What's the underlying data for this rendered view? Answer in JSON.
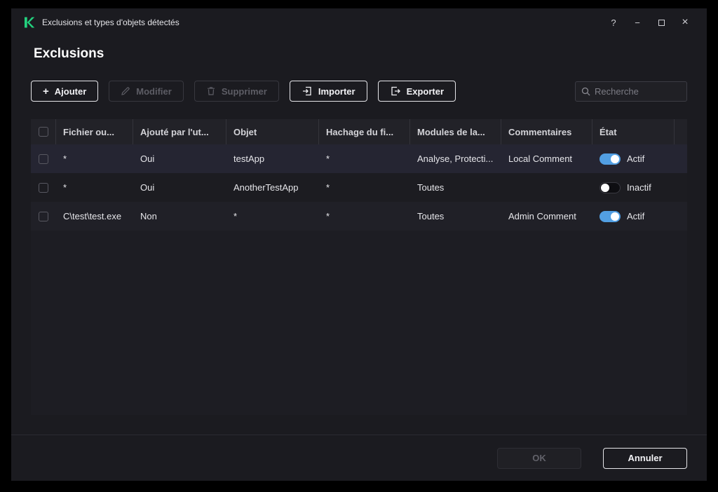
{
  "window": {
    "title": "Exclusions et types d'objets détectés",
    "controls": {
      "help": "?",
      "minimize": "−",
      "close": "×"
    }
  },
  "page": {
    "title": "Exclusions"
  },
  "toolbar": {
    "add": "Ajouter",
    "edit": "Modifier",
    "delete": "Supprimer",
    "import": "Importer",
    "export": "Exporter",
    "search_placeholder": "Recherche"
  },
  "table": {
    "columns": [
      "Fichier ou...",
      "Ajouté par l'ut...",
      "Objet",
      "Hachage du fi...",
      "Modules de la...",
      "Commentaires",
      "État"
    ],
    "rows": [
      {
        "file": "*",
        "added_by_user": "Oui",
        "object": "testApp",
        "hash": "*",
        "modules": "Analyse, Protecti...",
        "comment": "Local Comment",
        "state": "Actif",
        "enabled": true
      },
      {
        "file": "*",
        "added_by_user": "Oui",
        "object": "AnotherTestApp",
        "hash": "*",
        "modules": "Toutes",
        "comment": "",
        "state": "Inactif",
        "enabled": false
      },
      {
        "file": "C\\test\\test.exe",
        "added_by_user": "Non",
        "object": "*",
        "hash": "*",
        "modules": "Toutes",
        "comment": "Admin Comment",
        "state": "Actif",
        "enabled": true
      }
    ]
  },
  "footer": {
    "ok": "OK",
    "cancel": "Annuler"
  },
  "colors": {
    "accent_blue": "#529fe3",
    "brand_green": "#23d17e"
  }
}
